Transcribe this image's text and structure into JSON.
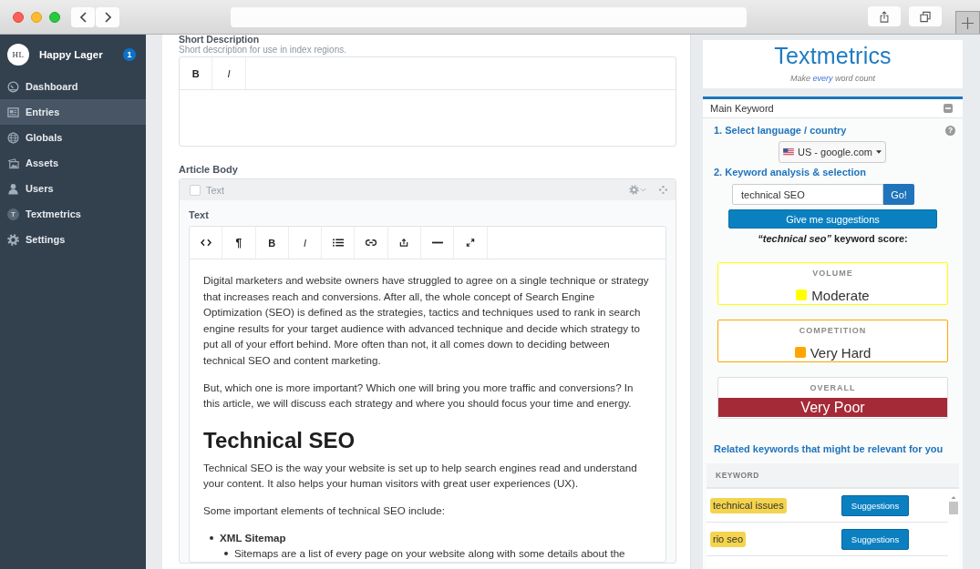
{
  "sidebar": {
    "logo": "HL",
    "site_name": "Happy Lager",
    "notification_count": "1",
    "items": [
      {
        "label": "Dashboard",
        "selected": false
      },
      {
        "label": "Entries",
        "selected": true
      },
      {
        "label": "Globals",
        "selected": false
      },
      {
        "label": "Assets",
        "selected": false
      },
      {
        "label": "Users",
        "selected": false
      },
      {
        "label": "Textmetrics",
        "selected": false,
        "icon_letter": "T"
      },
      {
        "label": "Settings",
        "selected": false
      }
    ]
  },
  "editor": {
    "short_description": {
      "label": "Short Description",
      "help": "Short description for use in index regions.",
      "toolbar": [
        {
          "kind": "bold",
          "label": "B"
        },
        {
          "kind": "italic",
          "label": "I"
        }
      ]
    },
    "article_body": {
      "label": "Article Body",
      "block": {
        "type_label": "Text",
        "checked": false,
        "field_label": "Text",
        "toolbar": [
          {
            "kind": "code"
          },
          {
            "kind": "paragraph",
            "label": "¶"
          },
          {
            "kind": "bold",
            "label": "B"
          },
          {
            "kind": "italic",
            "label": "I"
          },
          {
            "kind": "list"
          },
          {
            "kind": "link"
          },
          {
            "kind": "embed"
          },
          {
            "kind": "rule"
          },
          {
            "kind": "fullscreen"
          }
        ],
        "content": [
          {
            "kind": "paragraph",
            "text": "Digital marketers and website owners have struggled to agree on a single technique or strategy that increases reach and conversions. After all, the whole concept of Search Engine Optimization (SEO) is defined as the strategies, tactics and techniques used to rank in search engine results for your target audience with advanced technique and decide which strategy to put all of your effort behind. More often than not, it all comes down to deciding between technical SEO and content marketing."
          },
          {
            "kind": "paragraph",
            "text": "But, which one is more important? Which one will bring you more traffic and conversions? In this article, we will discuss each strategy and where you should focus your time and energy."
          },
          {
            "kind": "heading",
            "text": "Technical SEO"
          },
          {
            "kind": "paragraph",
            "text": "Technical SEO is the way your website is set up to help search engines read and understand your content. It also helps your human visitors with great user experiences (UX)."
          },
          {
            "kind": "paragraph",
            "text": "Some important elements of technical SEO include:"
          },
          {
            "kind": "list",
            "items": [
              {
                "text": "XML Sitemap",
                "children": [
                  {
                    "text": "Sitemaps are a list of every page on your website along with some details about the"
                  }
                ]
              }
            ]
          }
        ]
      }
    }
  },
  "textmetrics": {
    "brand": "Textmetrics",
    "tagline": "Make *every* word count",
    "panel": {
      "title": "Main Keyword",
      "expanded": true,
      "step1": "1. Select language / country",
      "help": "?",
      "country": "US - google.com",
      "step2": "2. Keyword analysis & selection",
      "keyword": "technical SEO",
      "go": "Go!",
      "suggest": "Give me suggestions",
      "score_title": "*“technical seo”* keyword score:",
      "scores": [
        {
          "kind": "indicator",
          "label": "VOLUME",
          "value": "Moderate",
          "color": "#ffff00"
        },
        {
          "kind": "indicator",
          "label": "COMPETITION",
          "value": "Very Hard",
          "color": "#ffa500"
        },
        {
          "kind": "banner",
          "label": "OVERALL",
          "value": "Very Poor",
          "color": "#a52a37"
        }
      ],
      "related_title": "Related keywords that might be relevant for you",
      "table": {
        "columns": [
          "KEYWORD"
        ],
        "rows": [
          {
            "keyword": "technical issues",
            "action": "Suggestions"
          },
          {
            "keyword": "rio seo",
            "action": "Suggestions"
          }
        ]
      }
    }
  }
}
